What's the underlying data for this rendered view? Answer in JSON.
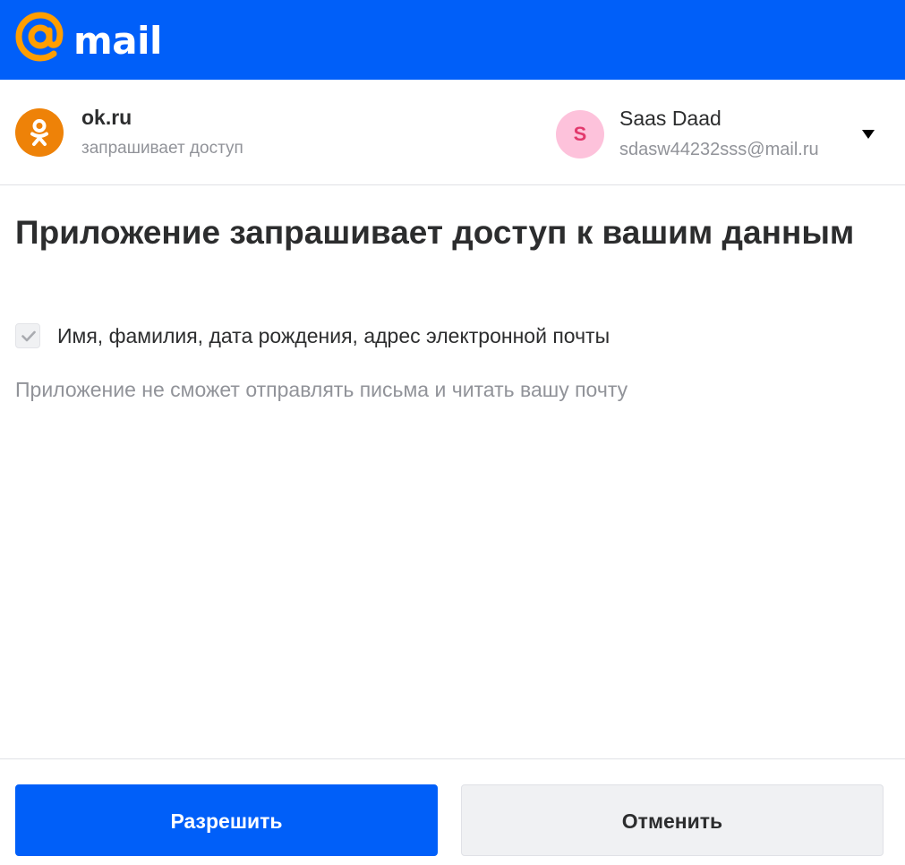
{
  "brand": {
    "logo_text": "mail",
    "logo_icon": "at-sign-icon",
    "bar_color": "#005ff9",
    "accent_color": "#ff9e00"
  },
  "app": {
    "name": "ok.ru",
    "subtitle": "запрашивает доступ",
    "icon": "odnoklassniki-icon",
    "icon_color": "#ee8208"
  },
  "account": {
    "avatar_letter": "S",
    "name": "Saas Daad",
    "email": "sdasw44232sss@mail.ru",
    "dropdown_icon": "caret-down-icon"
  },
  "content": {
    "title": "Приложение запрашивает доступ к вашим данным",
    "permissions": [
      {
        "label": "Имя, фамилия, дата рождения, адрес электронной почты",
        "checked": true,
        "disabled": true
      }
    ],
    "note": "Приложение не сможет отправлять письма и читать вашу почту"
  },
  "actions": {
    "allow_label": "Разрешить",
    "cancel_label": "Отменить"
  }
}
